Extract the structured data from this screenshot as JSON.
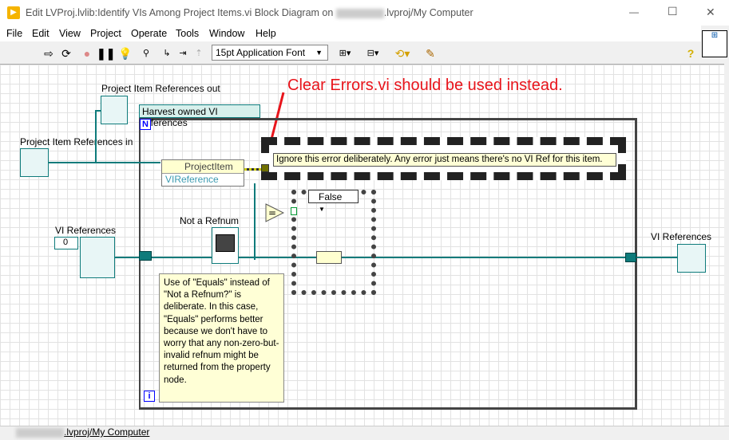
{
  "window": {
    "title_prefix": "Edit LVProj.lvlib:Identify VIs Among Project Items.vi Block Diagram on",
    "title_suffix": ".lvproj/My Computer",
    "minimize": "—",
    "maximize": "☐",
    "close": "✕"
  },
  "menu": [
    "File",
    "Edit",
    "View",
    "Project",
    "Operate",
    "Tools",
    "Window",
    "Help"
  ],
  "toolbar": {
    "font": "15pt Application Font",
    "help": "?"
  },
  "diagram": {
    "annotation": "Clear Errors.vi should be used instead.",
    "project_refs_out": "Project Item References out",
    "project_refs_in": "Project Item References in",
    "vi_refs_label": "VI References",
    "vi_refs_out_label": "VI References",
    "vi_refs_value": "0",
    "loop_label": "Harvest owned VI references",
    "loop_count": "N",
    "loop_index": "i",
    "property_class": "ProjectItem",
    "property_name": "VIReference",
    "not_a_refnum": "Not a Refnum",
    "case_selector": "False",
    "error_comment": "Ignore this error deliberately. Any error just means there's no VI Ref for this item.",
    "note": "Use of \"Equals\" instead of \"Not a Refnum?\"  is deliberate. In this case, \"Equals\" performs better because we don't have to worry that any non-zero-but-invalid  refnum might be returned from the property node.",
    "equals": "="
  },
  "status": {
    "path": ".lvproj/My Computer"
  },
  "colors": {
    "wire": "#0e7b7b",
    "annotation": "#e8141b",
    "note_bg": "#ffffd6"
  }
}
